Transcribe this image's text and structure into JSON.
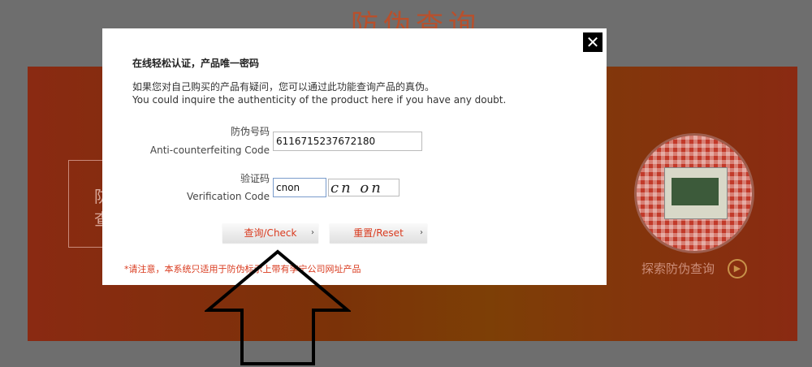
{
  "background": {
    "title": "防伪查询",
    "left_text": "防\n查",
    "explore_label": "探索防伪查询",
    "play_icon": "play-circle-icon"
  },
  "modal": {
    "heading": "在线轻松认证，产品唯一密码",
    "desc_cn": "如果您对自己购买的产品有疑问，您可以通过此功能查询产品的真伪。",
    "desc_en": "You could inquire the authenticity of the product here if you have any doubt.",
    "code_label_cn": "防伪号码",
    "code_label_en": "Anti-counterfeiting Code",
    "code_value": "6116715237672180",
    "verify_label_cn": "验证码",
    "verify_label_en": "Verification Code",
    "verify_value": "cnon",
    "captcha_text": "cn on",
    "check_label": "查询/Check",
    "reset_label": "重置/Reset",
    "notice": "*请注意，本系统只适用于防伪标示上带有李宁公司网址产品",
    "close_icon": "close-icon"
  },
  "colors": {
    "accent": "#d93a1e",
    "overlay": "#6e6e6e",
    "band": "#8a2a12"
  }
}
